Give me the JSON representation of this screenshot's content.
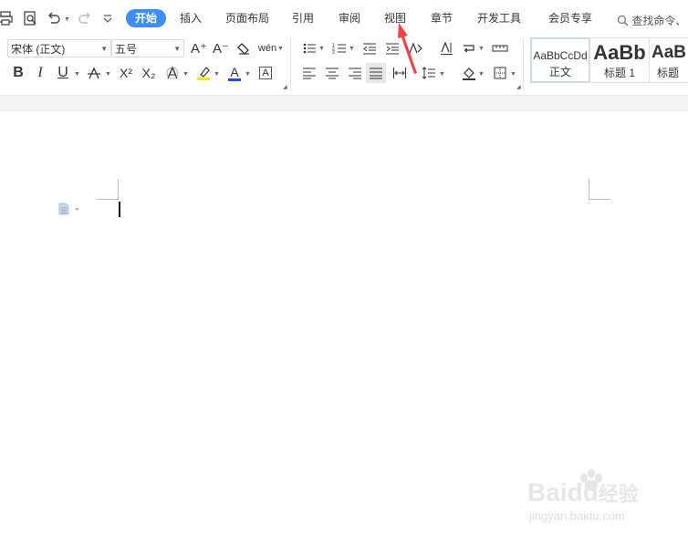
{
  "quick_access": {
    "icons": [
      "print-icon",
      "print-preview-icon",
      "undo-icon",
      "redo-icon",
      "more-icon"
    ]
  },
  "tabs": [
    {
      "label": "开始",
      "active": true
    },
    {
      "label": "插入",
      "active": false
    },
    {
      "label": "页面布局",
      "active": false
    },
    {
      "label": "引用",
      "active": false
    },
    {
      "label": "审阅",
      "active": false
    },
    {
      "label": "视图",
      "active": false
    },
    {
      "label": "章节",
      "active": false
    },
    {
      "label": "开发工具",
      "active": false
    },
    {
      "label": "会员专享",
      "active": false
    }
  ],
  "search": {
    "label": "查找命令、"
  },
  "font": {
    "name": "宋体 (正文)",
    "size": "五号"
  },
  "format_buttons": {
    "bold": "B",
    "italic": "I",
    "underline": "U",
    "superscript": "X²",
    "subscript": "X₂",
    "font_color": "A",
    "char_border": "A",
    "grow_font": "A⁺",
    "shrink_font": "A⁻",
    "phonetic": "wén"
  },
  "styles": [
    {
      "preview": "AaBbCcDd",
      "name": "正文",
      "selected": true
    },
    {
      "preview": "AaBb",
      "name": "标题 1",
      "selected": false
    },
    {
      "preview": "AaB",
      "name": "标题",
      "selected": false
    }
  ],
  "colors": {
    "accent": "#3f8cff",
    "highlight": "#ffe600",
    "font_color": "#1e4fe0",
    "arrow": "#f04343"
  },
  "watermark": {
    "brand": "Baidu",
    "suffix": "经验",
    "url": "jingyan.baidu.com"
  }
}
